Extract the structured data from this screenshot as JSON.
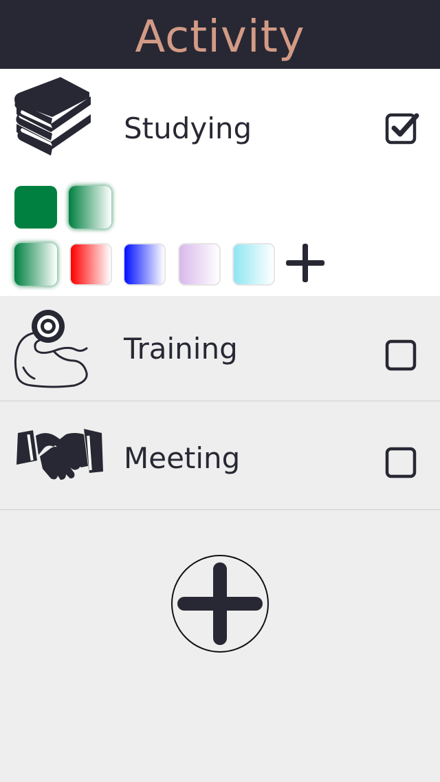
{
  "header": {
    "title": "Activity",
    "title_color": "#d39a86",
    "background": "#272833"
  },
  "activities": [
    {
      "label": "Studying",
      "icon": "books-icon",
      "checked": true,
      "expanded": true
    },
    {
      "label": "Training",
      "icon": "flexed-arm-weight-icon",
      "checked": false,
      "expanded": false
    },
    {
      "label": "Meeting",
      "icon": "handshake-icon",
      "checked": false,
      "expanded": false
    }
  ],
  "color_picker": {
    "current_swatches": [
      {
        "name": "solid-green",
        "colors": [
          "#008040",
          "#008040"
        ]
      },
      {
        "name": "green-gradient",
        "colors": [
          "#008040",
          "#ffffff"
        ],
        "selected": true
      }
    ],
    "palette": [
      {
        "name": "green-gradient",
        "colors": [
          "#008040",
          "#ffffff"
        ],
        "selected": true
      },
      {
        "name": "red-gradient",
        "colors": [
          "#ff0000",
          "#ffffff"
        ]
      },
      {
        "name": "blue-gradient",
        "colors": [
          "#0010ff",
          "#ffffff"
        ]
      },
      {
        "name": "lavender-gradient",
        "colors": [
          "#d8b8ec",
          "#ffffff"
        ]
      },
      {
        "name": "cyan-gradient",
        "colors": [
          "#8fe6f2",
          "#ffffff"
        ]
      }
    ],
    "add_icon": "plus-icon"
  },
  "footer": {
    "add_icon": "plus-circle-icon"
  },
  "colors": {
    "dark": "#272833",
    "accent": "#d39a86",
    "row_background": "#eeeeee",
    "expanded_background": "#ffffff"
  }
}
